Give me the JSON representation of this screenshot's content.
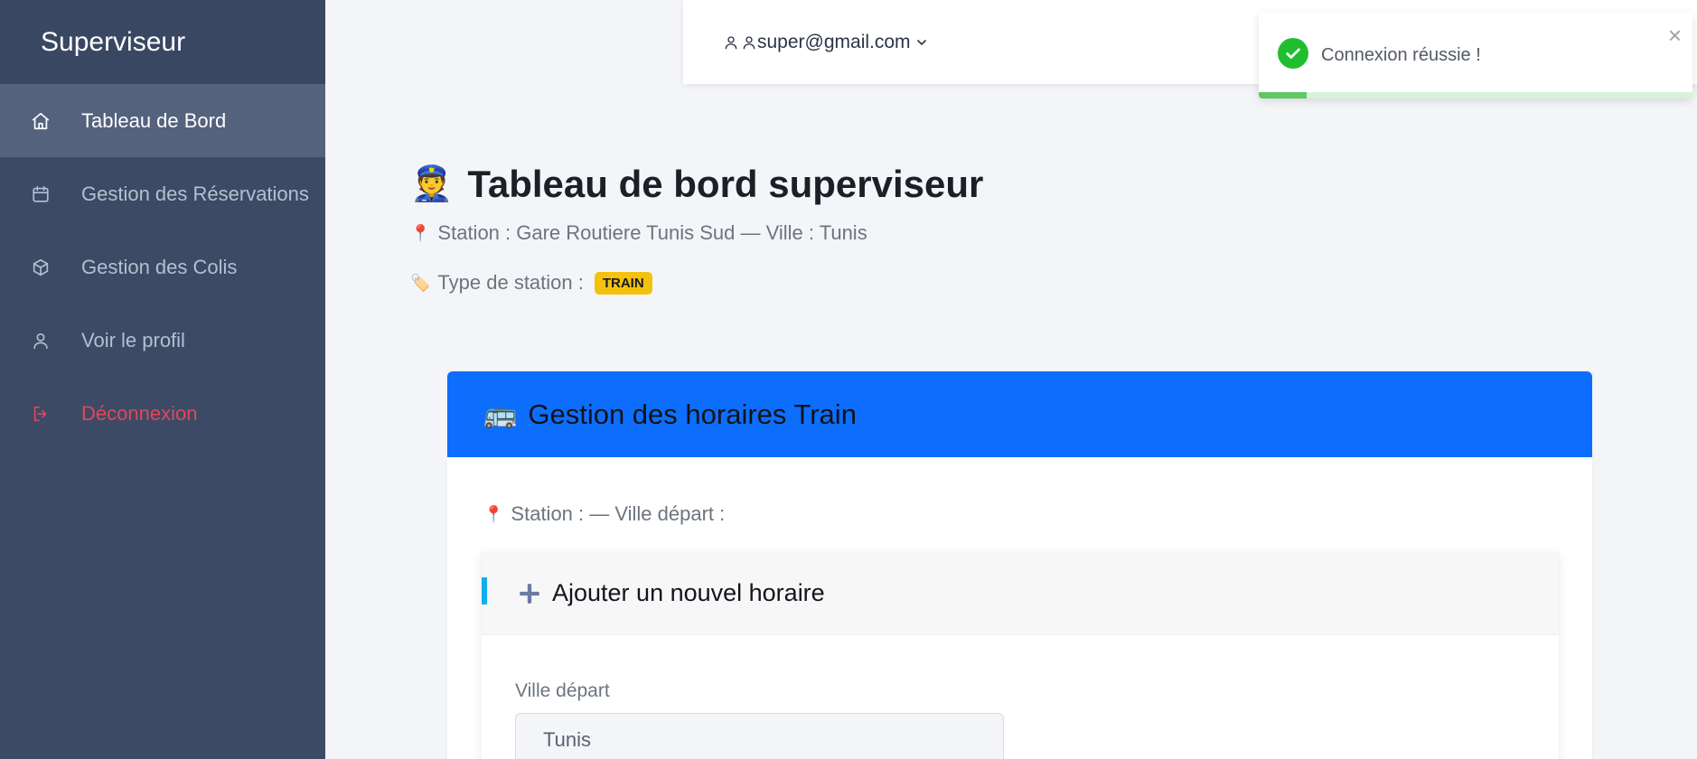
{
  "sidebar": {
    "brand": "Superviseur",
    "items": [
      {
        "label": "Tableau de Bord",
        "icon": "home-icon"
      },
      {
        "label": "Gestion des Réservations",
        "icon": "calendar-icon"
      },
      {
        "label": "Gestion des Colis",
        "icon": "package-icon"
      },
      {
        "label": "Voir le profil",
        "icon": "user-icon"
      },
      {
        "label": "Déconnexion",
        "icon": "logout-icon"
      }
    ]
  },
  "topbar": {
    "user_email": "super@gmail.com"
  },
  "toast": {
    "message": "Connexion réussie !",
    "close": "×",
    "progress": 0.11
  },
  "header": {
    "title_emoji": "👮",
    "title": "Tableau de bord superviseur",
    "station_emoji": "📍",
    "station_line": "Station : Gare Routiere Tunis Sud — Ville : Tunis",
    "type_emoji": "🏷️",
    "type_label": "Type de station :",
    "type_badge": "TRAIN"
  },
  "card": {
    "title_emoji": "🚌",
    "title": "Gestion des horaires Train",
    "sub_emoji": "📍",
    "sub_line": "Station : — Ville départ :",
    "add_title": "Ajouter un nouvel horaire",
    "field_label": "Ville départ",
    "field_value": "Tunis"
  },
  "colors": {
    "sidebar": "#3c4a66",
    "primary": "#0d6efd",
    "danger": "#e0475a",
    "success": "#1fbe2f",
    "badge": "#f4c20d"
  }
}
